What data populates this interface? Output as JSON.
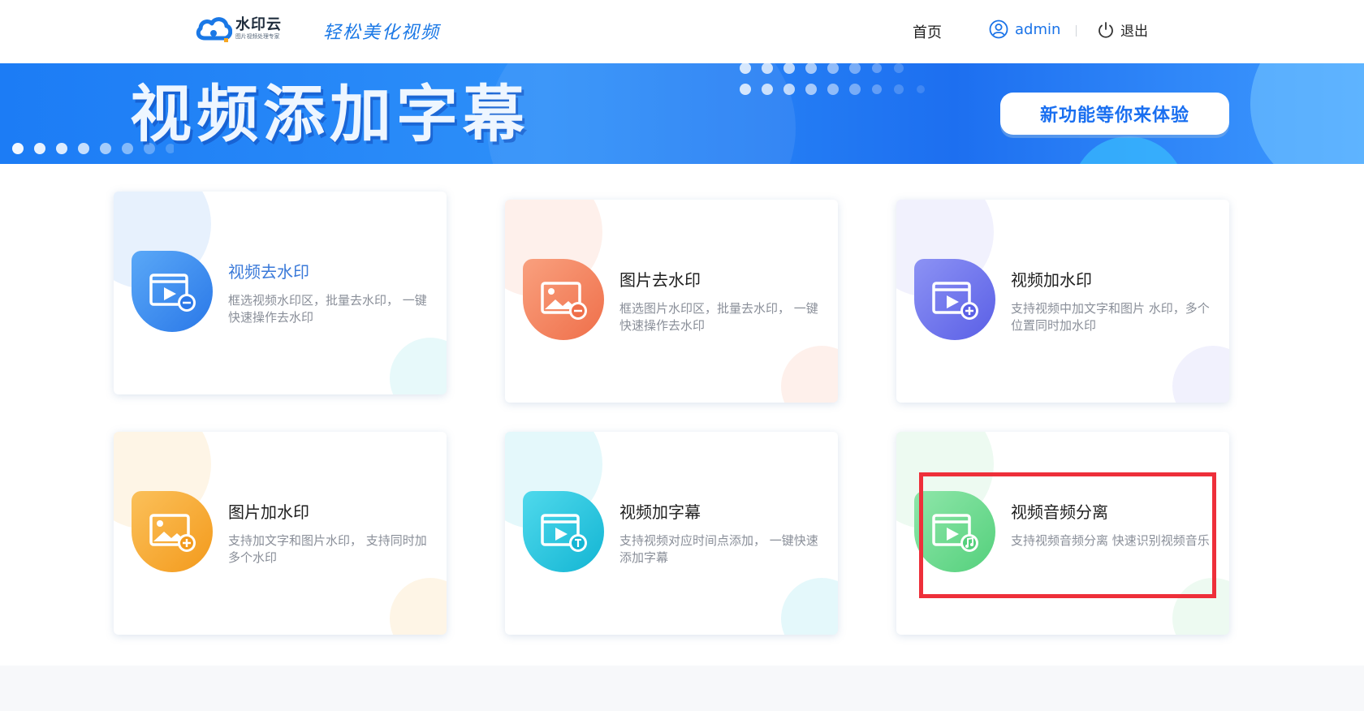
{
  "header": {
    "logo": {
      "name": "水印云",
      "subtitle": "图片视频处理专家"
    },
    "slogan": "轻松美化视频",
    "nav": {
      "home": "首页",
      "user": "admin",
      "logout": "退出"
    }
  },
  "banner": {
    "title": "视频添加字幕",
    "button": "新功能等你来体验"
  },
  "cards": [
    {
      "title": "视频去水印",
      "desc": "框选视频水印区，批量去水印， 一键快速操作去水印",
      "icon": "video-remove-icon",
      "color": "#3b8cf0"
    },
    {
      "title": "图片去水印",
      "desc": "框选图片水印区，批量去水印， 一键快速操作去水印",
      "icon": "image-remove-icon",
      "color": "#f3845e"
    },
    {
      "title": "视频加水印",
      "desc": "支持视频中加文字和图片 水印，多个位置同时加水印",
      "icon": "video-add-icon",
      "color": "#6f74ee"
    },
    {
      "title": "图片加水印",
      "desc": "支持加文字和图片水印， 支持同时加多个水印",
      "icon": "image-add-icon",
      "color": "#f7a935"
    },
    {
      "title": "视频加字幕",
      "desc": "支持视频对应时间点添加， 一键快速添加字幕",
      "icon": "video-subtitle-icon",
      "color": "#1fc6de"
    },
    {
      "title": "视频音频分离",
      "desc": "支持视频音频分离 快速识别视频音乐",
      "icon": "video-audio-icon",
      "color": "#6ad98f"
    }
  ],
  "colors": {
    "accent": "#1a73e8",
    "highlight": "#ee2f3a"
  }
}
